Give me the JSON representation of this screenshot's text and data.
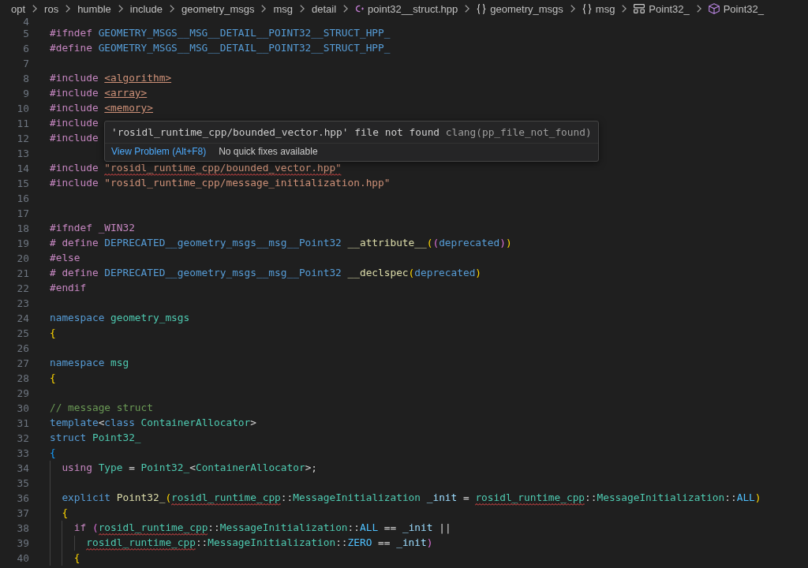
{
  "breadcrumb": [
    {
      "text": "opt",
      "kind": "folder"
    },
    {
      "text": "ros",
      "kind": "folder"
    },
    {
      "text": "humble",
      "kind": "folder"
    },
    {
      "text": "include",
      "kind": "folder"
    },
    {
      "text": "geometry_msgs",
      "kind": "folder"
    },
    {
      "text": "msg",
      "kind": "folder"
    },
    {
      "text": "detail",
      "kind": "folder"
    },
    {
      "text": "point32__struct.hpp",
      "kind": "file"
    },
    {
      "text": "geometry_msgs",
      "kind": "namespace"
    },
    {
      "text": "msg",
      "kind": "namespace"
    },
    {
      "text": "Point32_",
      "kind": "struct"
    },
    {
      "text": "Point32_",
      "kind": "method"
    }
  ],
  "editor": {
    "lines": [
      {
        "number": "4"
      },
      {
        "number": "5",
        "tokens": [
          {
            "text": "#ifndef ",
            "kind": "directive"
          },
          {
            "text": "GEOMETRY_MSGS__MSG__DETAIL__POINT32__STRUCT_HPP_",
            "kind": "macro"
          }
        ]
      },
      {
        "number": "6",
        "tokens": [
          {
            "text": "#define ",
            "kind": "directive"
          },
          {
            "text": "GEOMETRY_MSGS__MSG__DETAIL__POINT32__STRUCT_HPP_",
            "kind": "macro"
          }
        ]
      },
      {
        "number": "7"
      },
      {
        "number": "8",
        "tokens": [
          {
            "text": "#include ",
            "kind": "directive"
          },
          {
            "text": "<algorithm>",
            "kind": "include-link"
          }
        ]
      },
      {
        "number": "9",
        "tokens": [
          {
            "text": "#include ",
            "kind": "directive"
          },
          {
            "text": "<array>",
            "kind": "include-link"
          }
        ]
      },
      {
        "number": "10",
        "tokens": [
          {
            "text": "#include ",
            "kind": "directive"
          },
          {
            "text": "<memory>",
            "kind": "include-link"
          }
        ]
      },
      {
        "number": "11",
        "tokens": [
          {
            "text": "#include",
            "kind": "directive"
          }
        ]
      },
      {
        "number": "12",
        "tokens": [
          {
            "text": "#include",
            "kind": "directive"
          }
        ]
      },
      {
        "number": "13"
      },
      {
        "number": "14",
        "tokens": [
          {
            "text": "#include ",
            "kind": "directive"
          },
          {
            "text": "\"rosidl_runtime_cpp/bounded_vector.hpp\"",
            "kind": "string-error"
          }
        ]
      },
      {
        "number": "15",
        "tokens": [
          {
            "text": "#include ",
            "kind": "directive"
          },
          {
            "text": "\"rosidl_runtime_cpp/message_initialization.hpp\"",
            "kind": "string"
          }
        ]
      },
      {
        "number": "16"
      },
      {
        "number": "17"
      },
      {
        "number": "18",
        "tokens": [
          {
            "text": "#ifndef _WIN32",
            "kind": "directive"
          }
        ]
      },
      {
        "number": "19",
        "tokens": [
          {
            "text": "# define ",
            "kind": "directive"
          },
          {
            "text": "DEPRECATED__geometry_msgs__msg__Point32 ",
            "kind": "macro"
          },
          {
            "text": "__attribute__",
            "kind": "function"
          },
          {
            "text": "(",
            "kind": "bracket1"
          },
          {
            "text": "(",
            "kind": "bracket2"
          },
          {
            "text": "deprecated",
            "kind": "keyword"
          },
          {
            "text": ")",
            "kind": "bracket2"
          },
          {
            "text": ")",
            "kind": "bracket1"
          }
        ]
      },
      {
        "number": "20",
        "tokens": [
          {
            "text": "#else",
            "kind": "directive"
          }
        ]
      },
      {
        "number": "21",
        "tokens": [
          {
            "text": "# define ",
            "kind": "directive"
          },
          {
            "text": "DEPRECATED__geometry_msgs__msg__Point32 ",
            "kind": "macro"
          },
          {
            "text": "__declspec",
            "kind": "function"
          },
          {
            "text": "(",
            "kind": "bracket1"
          },
          {
            "text": "deprecated",
            "kind": "keyword"
          },
          {
            "text": ")",
            "kind": "bracket1"
          }
        ]
      },
      {
        "number": "22",
        "tokens": [
          {
            "text": "#endif",
            "kind": "directive"
          }
        ]
      },
      {
        "number": "23"
      },
      {
        "number": "24",
        "tokens": [
          {
            "text": "namespace ",
            "kind": "keyword"
          },
          {
            "text": "geometry_msgs",
            "kind": "type"
          }
        ]
      },
      {
        "number": "25",
        "tokens": [
          {
            "text": "{",
            "kind": "bracket1"
          }
        ]
      },
      {
        "number": "26"
      },
      {
        "number": "27",
        "tokens": [
          {
            "text": "namespace ",
            "kind": "keyword"
          },
          {
            "text": "msg",
            "kind": "type"
          }
        ]
      },
      {
        "number": "28",
        "tokens": [
          {
            "text": "{",
            "kind": "bracket1"
          }
        ]
      },
      {
        "number": "29"
      },
      {
        "number": "30",
        "tokens": [
          {
            "text": "// message struct",
            "kind": "comment"
          }
        ]
      },
      {
        "number": "31",
        "tokens": [
          {
            "text": "template",
            "kind": "keyword"
          },
          {
            "text": "<",
            "kind": "plain"
          },
          {
            "text": "class ",
            "kind": "keyword"
          },
          {
            "text": "ContainerAllocator",
            "kind": "type"
          },
          {
            "text": ">",
            "kind": "plain"
          }
        ]
      },
      {
        "number": "32",
        "tokens": [
          {
            "text": "struct ",
            "kind": "keyword"
          },
          {
            "text": "Point32_",
            "kind": "type"
          }
        ]
      },
      {
        "number": "33",
        "tokens": [
          {
            "text": "{",
            "kind": "bracket3"
          }
        ]
      },
      {
        "number": "34",
        "tokens": [
          {
            "text": "  using ",
            "kind": "control"
          },
          {
            "text": "Type",
            "kind": "type"
          },
          {
            "text": " = ",
            "kind": "plain"
          },
          {
            "text": "Point32_",
            "kind": "type"
          },
          {
            "text": "<",
            "kind": "plain"
          },
          {
            "text": "ContainerAllocator",
            "kind": "type"
          },
          {
            "text": ">;",
            "kind": "plain"
          }
        ]
      },
      {
        "number": "35"
      },
      {
        "number": "36",
        "tokens": [
          {
            "text": "  explicit ",
            "kind": "keyword"
          },
          {
            "text": "Point32_",
            "kind": "function"
          },
          {
            "text": "(",
            "kind": "bracket1"
          },
          {
            "text": "rosidl_runtime_cpp",
            "kind": "type-error"
          },
          {
            "text": "::",
            "kind": "plain"
          },
          {
            "text": "MessageInitialization ",
            "kind": "type"
          },
          {
            "text": "_init",
            "kind": "variable"
          },
          {
            "text": " = ",
            "kind": "plain"
          },
          {
            "text": "rosidl_runtime_cpp",
            "kind": "type-error"
          },
          {
            "text": "::",
            "kind": "plain"
          },
          {
            "text": "MessageInitialization",
            "kind": "type"
          },
          {
            "text": "::",
            "kind": "plain"
          },
          {
            "text": "ALL",
            "kind": "enum"
          },
          {
            "text": ")",
            "kind": "bracket1"
          }
        ]
      },
      {
        "number": "37",
        "tokens": [
          {
            "text": "  {",
            "kind": "bracket1"
          }
        ]
      },
      {
        "number": "38",
        "tokens": [
          {
            "text": "    if ",
            "kind": "control"
          },
          {
            "text": "(",
            "kind": "bracket2"
          },
          {
            "text": "rosidl_runtime_cpp",
            "kind": "type-error"
          },
          {
            "text": "::",
            "kind": "plain"
          },
          {
            "text": "MessageInitialization",
            "kind": "type"
          },
          {
            "text": "::",
            "kind": "plain"
          },
          {
            "text": "ALL",
            "kind": "enum"
          },
          {
            "text": " == ",
            "kind": "plain"
          },
          {
            "text": "_init",
            "kind": "variable"
          },
          {
            "text": " ||",
            "kind": "plain"
          }
        ]
      },
      {
        "number": "39",
        "tokens": [
          {
            "text": "      rosidl_runtime_cpp",
            "kind": "type-error"
          },
          {
            "text": "::",
            "kind": "plain"
          },
          {
            "text": "MessageInitialization",
            "kind": "type"
          },
          {
            "text": "::",
            "kind": "plain"
          },
          {
            "text": "ZERO",
            "kind": "enum"
          },
          {
            "text": " == ",
            "kind": "plain"
          },
          {
            "text": "_init",
            "kind": "variable"
          },
          {
            "text": ")",
            "kind": "bracket2"
          }
        ]
      },
      {
        "number": "40",
        "tokens": [
          {
            "text": "    {",
            "kind": "bracket1"
          }
        ]
      }
    ]
  },
  "hover": {
    "message": "'rosidl_runtime_cpp/bounded_vector.hpp' file not found",
    "source": "clang(pp_file_not_found)",
    "action": "View Problem (Alt+F8)",
    "note": "No quick fixes available"
  }
}
